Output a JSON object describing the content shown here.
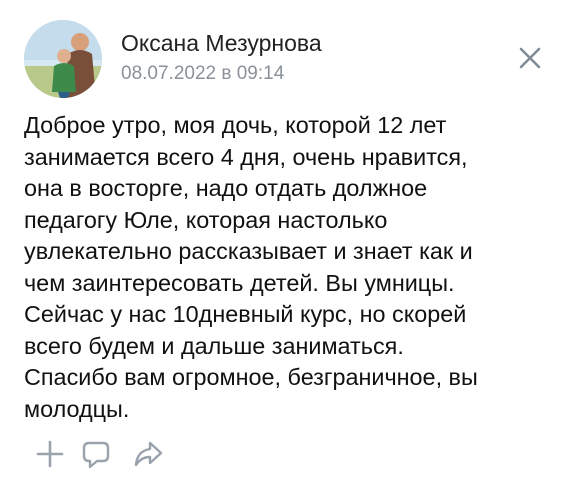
{
  "post": {
    "author_name": "Оксана Мезурнова",
    "date": "08.07.2022 в 09:14",
    "text_lines": [
      "Доброе утро, моя дочь, которой 12 лет",
      "занимается всего 4 дня, очень нравится,",
      "она в восторге, надо отдать должное",
      "педагогу Юле, которая настолько",
      "увлекательно рассказывает и знает как и",
      "чем заинтересовать детей. Вы умницы.",
      "Сейчас у нас 10дневный курс, но скорей",
      "всего будем и дальше заниматься.",
      "Спасибо вам огромное, безграничное, вы",
      "молодцы."
    ]
  },
  "icons": {
    "close": "close-icon",
    "add": "plus-icon",
    "comment": "comment-icon",
    "share": "share-icon"
  },
  "colors": {
    "name": "#222222",
    "date": "#8a9199",
    "text": "#111111",
    "icon": "#99a2ad",
    "close": "#818c99"
  }
}
